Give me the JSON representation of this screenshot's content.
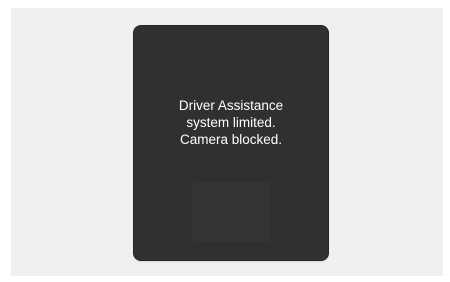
{
  "warning": {
    "lines": [
      "Driver Assistance",
      "system limited.",
      "Camera blocked."
    ]
  },
  "colors": {
    "page_background": "#f0f0f0",
    "panel_background": "#303030",
    "text": "#ffffff"
  }
}
